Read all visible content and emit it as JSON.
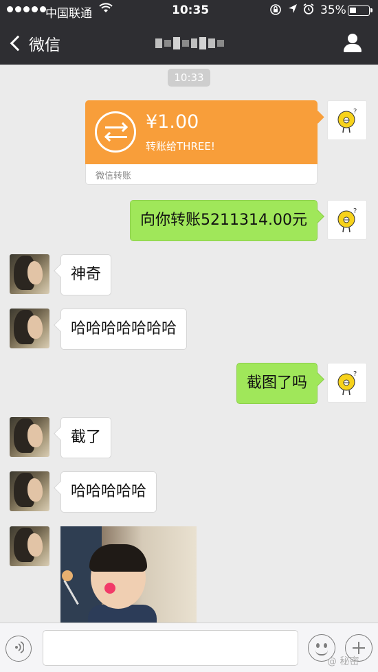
{
  "status_bar": {
    "carrier": "中国联通",
    "time": "10:35",
    "battery_percent": "35%",
    "battery_level": 0.35,
    "icons": [
      "signal-dots-icon",
      "wifi-icon",
      "rotation-lock-icon",
      "location-icon",
      "alarm-icon",
      "battery-icon"
    ]
  },
  "nav": {
    "back_label": "微信",
    "title_pixelated": true,
    "right_icon": "person-icon"
  },
  "chat": {
    "timestamp": "10:33",
    "transfer": {
      "amount": "¥1.00",
      "description": "转账给THREE!",
      "footer": "微信转账"
    },
    "messages": [
      {
        "side": "sent",
        "text": "向你转账5211314.00元"
      },
      {
        "side": "received",
        "text": "神奇"
      },
      {
        "side": "received",
        "text": "哈哈哈哈哈哈哈"
      },
      {
        "side": "sent",
        "text": "截图了吗"
      },
      {
        "side": "received",
        "text": "截了"
      },
      {
        "side": "received",
        "text": "哈哈哈哈哈"
      },
      {
        "side": "received",
        "type": "image"
      }
    ]
  },
  "colors": {
    "nav_bg": "#2e2e32",
    "chat_bg": "#ebebeb",
    "sent_bubble": "#a0e75a",
    "transfer_orange": "#f89e3a"
  },
  "watermark": "@ 秘密"
}
